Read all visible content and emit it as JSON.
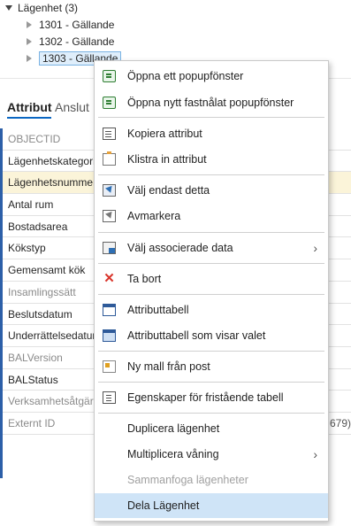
{
  "tree": {
    "parent_label": "Lägenhet (3)",
    "children": [
      "1301 - Gällande",
      "1302 - Gällande",
      "1303 - Gällande"
    ]
  },
  "tabs": {
    "active": "Attribut",
    "inactive": "Anslut"
  },
  "attributes": [
    {
      "name": "OBJECTID",
      "value": ""
    },
    {
      "name": "Lägenhetskategori",
      "value": ""
    },
    {
      "name": "Lägenhetsnummer",
      "value": ""
    },
    {
      "name": "Antal rum",
      "value": ""
    },
    {
      "name": "Bostadsarea",
      "value": ""
    },
    {
      "name": "Kökstyp",
      "value": ""
    },
    {
      "name": "Gemensamt kök",
      "value": ""
    },
    {
      "name": "Insamlingssätt",
      "value": ""
    },
    {
      "name": "Beslutsdatum",
      "value": ""
    },
    {
      "name": "Underrättelsedatum",
      "value": ""
    },
    {
      "name": "BALVersion",
      "value": ""
    },
    {
      "name": "BALStatus",
      "value": ""
    },
    {
      "name": "Verksamhetsåtgärd",
      "value": ""
    },
    {
      "name": "Externt ID",
      "value": "679)"
    }
  ],
  "menu": {
    "open_popup": "Öppna ett popupfönster",
    "open_pinned_popup": "Öppna nytt fastnålat popupfönster",
    "copy_attributes": "Kopiera attribut",
    "paste_attributes": "Klistra in attribut",
    "select_only_this": "Välj endast detta",
    "deselect": "Avmarkera",
    "select_associated": "Välj associerade data",
    "delete": "Ta bort",
    "attribute_table": "Attributtabell",
    "attribute_table_selection": "Attributtabell som visar valet",
    "new_template": "Ny mall från post",
    "standalone_properties": "Egenskaper för fristående tabell",
    "duplicate_apartment": "Duplicera lägenhet",
    "multiply_floor": "Multiplicera våning",
    "merge_apartments": "Sammanfoga lägenheter",
    "split_apartment": "Dela Lägenhet",
    "submenu_arrow": "›"
  }
}
